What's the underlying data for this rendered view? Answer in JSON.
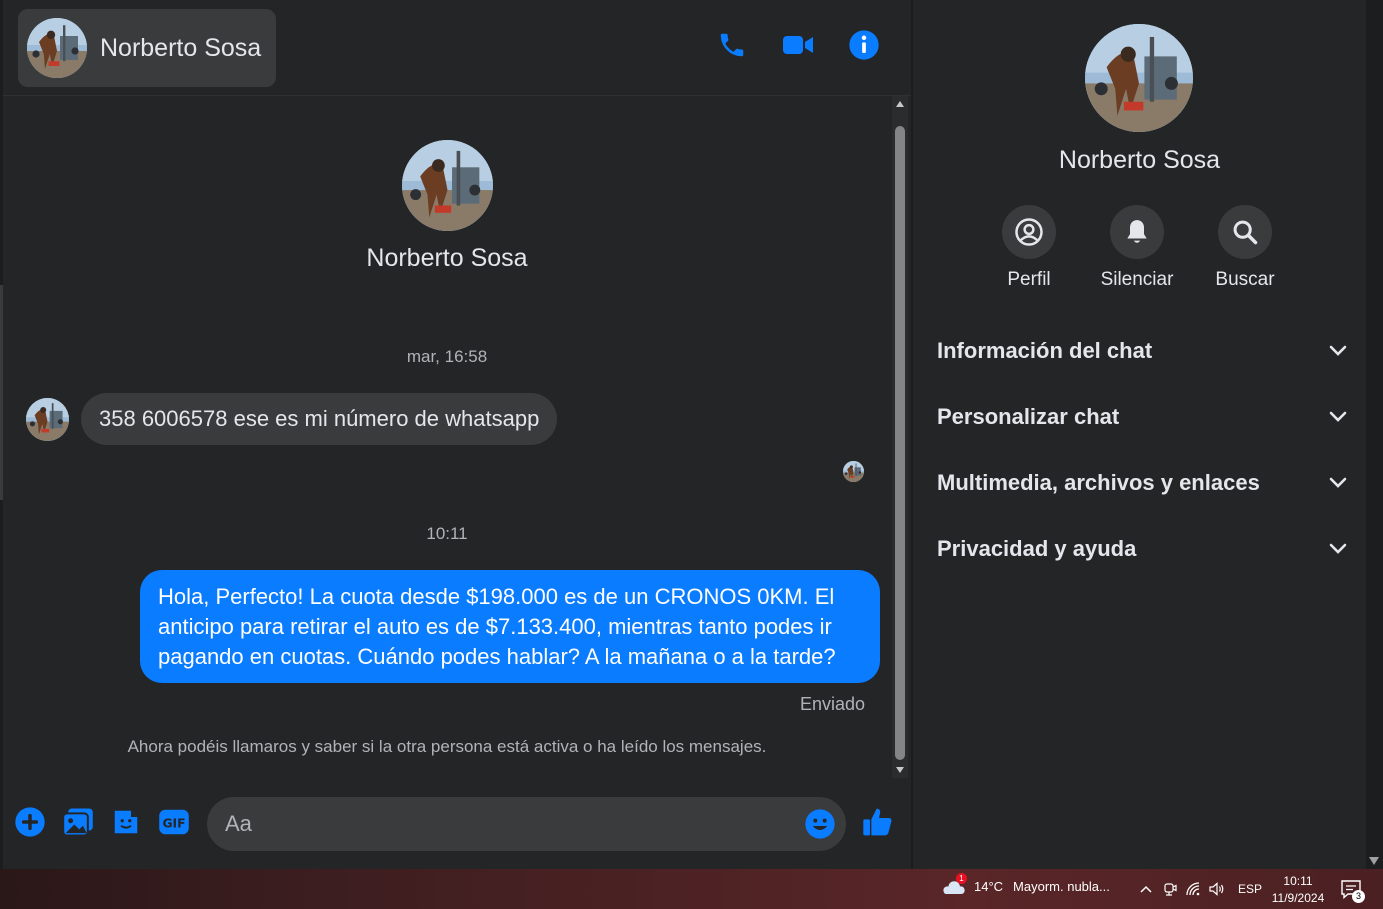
{
  "contact": {
    "name": "Norberto Sosa"
  },
  "header": {
    "icons": [
      "phone-icon",
      "video-camera-icon",
      "info-icon"
    ]
  },
  "conversation": {
    "timestamp_1": "mar, 16:58",
    "incoming_message": "358 6006578  ese es mi número de whatsapp",
    "timestamp_2": "10:11",
    "outgoing_message": "Hola, Perfecto! La cuota desde $198.000 es de un CRONOS 0KM. El anticipo para retirar el auto es de $7.133.400, mientras tanto podes ir pagando en cuotas. Cuándo podes hablar? A la mañana o a la tarde?",
    "sent_status": "Enviado",
    "info_note": "Ahora podéis llamaros y saber si la otra persona está activa o ha leído los mensajes."
  },
  "composer": {
    "placeholder": "Aa"
  },
  "side_panel": {
    "name": "Norberto Sosa",
    "actions": [
      {
        "label": "Perfil",
        "icon": "profile-icon"
      },
      {
        "label": "Silenciar",
        "icon": "bell-icon"
      },
      {
        "label": "Buscar",
        "icon": "search-icon"
      }
    ],
    "sections": [
      {
        "title": "Información del chat"
      },
      {
        "title": "Personalizar chat"
      },
      {
        "title": "Multimedia, archivos y enlaces"
      },
      {
        "title": "Privacidad y ayuda"
      }
    ]
  },
  "taskbar": {
    "weather_badge": "1",
    "weather_temp": "14°C",
    "weather_text": "Mayorm. nubla...",
    "language": "ESP",
    "time": "10:11",
    "date": "11/9/2024",
    "notification_count": "3"
  },
  "colors": {
    "accent": "#0a7cff",
    "background": "#242526",
    "bubble_in": "#3a3b3c"
  }
}
